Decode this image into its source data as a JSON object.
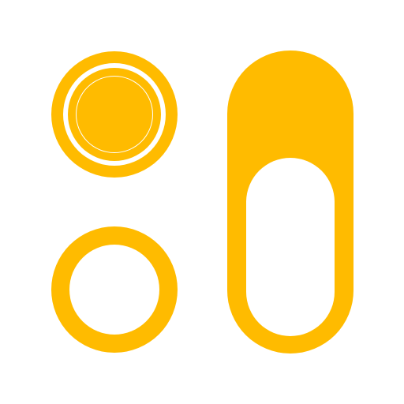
{
  "icon": {
    "name": "radio-buttons-and-toggle-switch-icon",
    "accent_color": "#ffbb00",
    "background_color": "#ffffff",
    "radio_selected": {
      "state": "selected"
    },
    "radio_unselected": {
      "state": "unselected"
    },
    "toggle_switch": {
      "state": "off"
    }
  }
}
